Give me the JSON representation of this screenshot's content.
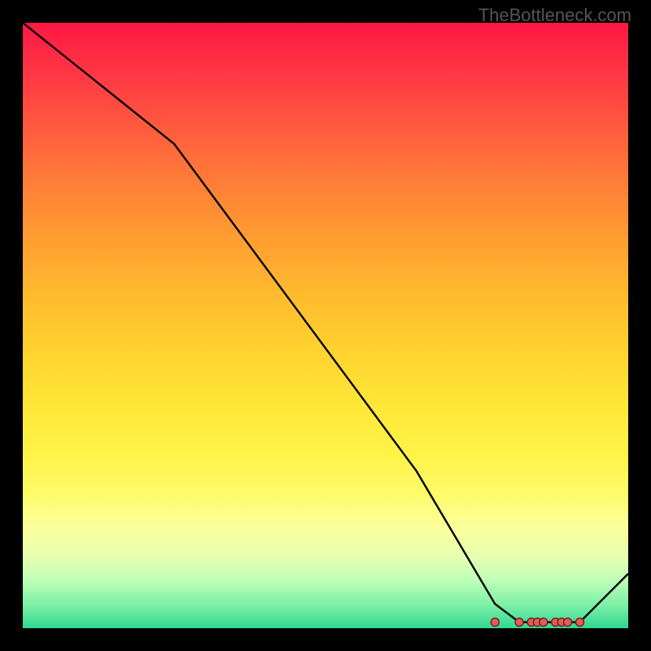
{
  "watermark": "TheBottleneck.com",
  "chart_data": {
    "type": "line",
    "title": "",
    "xlabel": "",
    "ylabel": "",
    "xlim": [
      0,
      100
    ],
    "ylim": [
      0,
      100
    ],
    "x": [
      0,
      10,
      25,
      45,
      65,
      78,
      82,
      84,
      86,
      88,
      90,
      92,
      100
    ],
    "values": [
      100,
      92,
      80,
      53,
      26,
      4,
      1,
      1,
      1,
      1,
      1,
      1,
      9
    ],
    "markers": {
      "x": [
        78,
        82,
        84,
        85,
        86,
        88,
        89,
        90,
        92
      ],
      "values": [
        1.0,
        1.0,
        1.0,
        1.0,
        1.0,
        1.0,
        1.0,
        1.0,
        1.0
      ]
    },
    "colors": {
      "line": "#000000",
      "marker_fill": "#e55b5b",
      "marker_stroke": "#7a1f1f",
      "gradient_top": "#ff1744",
      "gradient_bottom": "#30d890"
    }
  }
}
